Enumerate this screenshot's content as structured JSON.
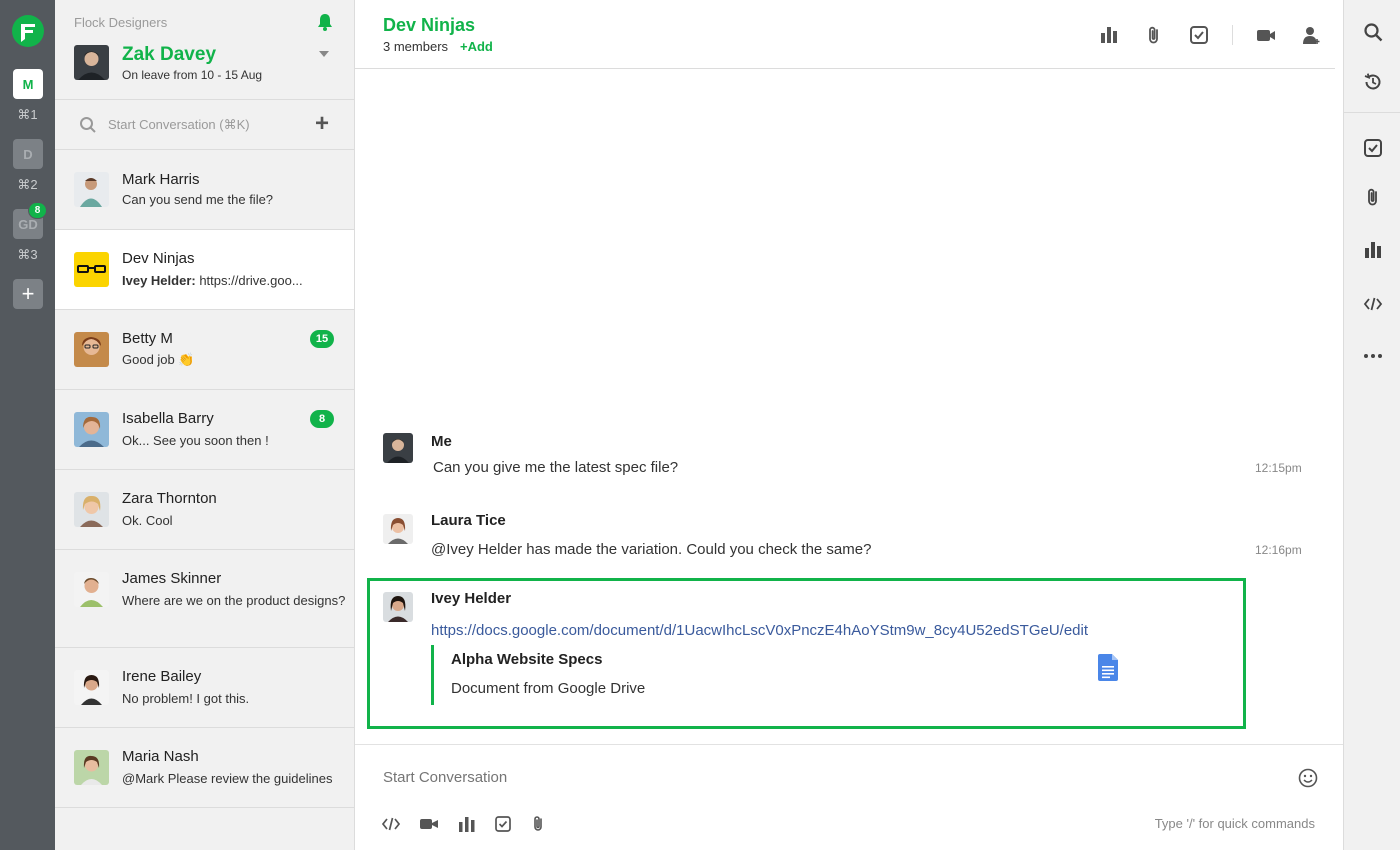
{
  "rail": {
    "teams": [
      {
        "initial": "M",
        "shortcut": "⌘1"
      },
      {
        "initial": "D",
        "shortcut": "⌘2"
      },
      {
        "initial": "GD",
        "shortcut": "⌘3",
        "badge": "8"
      }
    ],
    "add_label": "+"
  },
  "profile": {
    "team_name": "Flock Designers",
    "name": "Zak Davey",
    "status": "On leave from 10 - 15 Aug"
  },
  "search": {
    "placeholder": "Start Conversation (⌘K)"
  },
  "conversations": [
    {
      "name": "Mark Harris",
      "preview": "Can you send me the file?"
    },
    {
      "name": "Dev Ninjas",
      "preview_sender": "Ivey Helder:",
      "preview": " https://drive.goo..."
    },
    {
      "name": "Betty M",
      "preview": "Good job 👏",
      "badge": "15"
    },
    {
      "name": "Isabella Barry",
      "preview": "Ok... See you soon then !",
      "badge": "8"
    },
    {
      "name": "Zara Thornton",
      "preview": "Ok. Cool"
    },
    {
      "name": "James Skinner",
      "preview": "Where are we on the product designs?"
    },
    {
      "name": "Irene Bailey",
      "preview": "No problem! I got this."
    },
    {
      "name": "Maria Nash",
      "preview": "@Mark Please review the guidelines"
    }
  ],
  "chat": {
    "title": "Dev Ninjas",
    "members": "3 members",
    "add": "+Add",
    "messages": [
      {
        "sender": "Me",
        "text": "Can you give me the latest spec file?",
        "time": "12:15pm"
      },
      {
        "sender": "Laura Tice",
        "text": "@Ivey Helder has made the variation. Could you check the same?",
        "time": "12:16pm"
      },
      {
        "sender": "Ivey Helder",
        "link": "https://docs.google.com/document/d/1UacwIhcLscV0xPnczE4hAoYStm9w_8cy4U52edSTGeU/edit",
        "preview_title": "Alpha Website Specs",
        "preview_subtitle": "Document from Google Drive"
      }
    ]
  },
  "composer": {
    "placeholder": "Start Conversation",
    "hint": "Type '/' for quick commands"
  },
  "colors": {
    "brand_green": "#11b34a",
    "rail_dark": "#54595e",
    "link_blue": "#3a5a9c"
  }
}
